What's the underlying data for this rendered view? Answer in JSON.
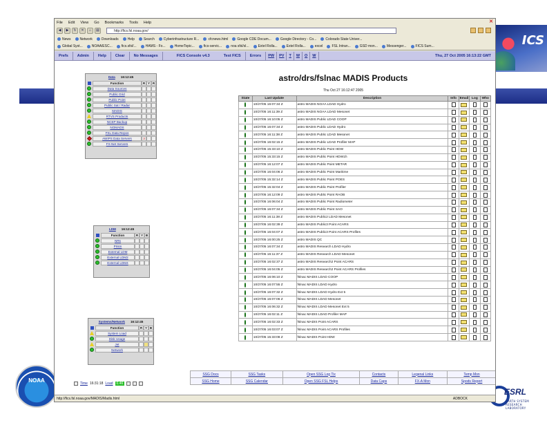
{
  "browser": {
    "menu": [
      "File",
      "Edit",
      "View",
      "Go",
      "Bookmarks",
      "Tools",
      "Help"
    ],
    "url": "http://fics.fsl.noaa.gov/",
    "bookmarks_row1": [
      "News",
      "Network",
      "Downloads",
      "Help",
      "Search",
      "Cyberinfrastructure R...",
      "cfcnews.html",
      "Google CDE Docum...",
      "Google Directory - Co...",
      "Colorado State Univer..."
    ],
    "bookmarks_row2": [
      "Global Syst...",
      "NOAA/ESC...",
      "fics.sfsl/...",
      "HAMS - Fo...",
      "HomeTopic...",
      "fics-servic...",
      "noa sfsl/sl...",
      "Extel Rolla...",
      "Extel Rolla...",
      "excel",
      "FSL Intran...",
      "GSD mon...",
      "Messenger...",
      "FICS Sum..."
    ],
    "status_url": "http://fics.fsl.noaa.gov/MADIS/Madis.html",
    "status_right": "ADBOCK"
  },
  "ssg_nav": {
    "tabs": [
      "Prefs",
      "Admin",
      "Help",
      "Clear",
      "No Messages"
    ],
    "title": "FICS Console v4.3",
    "tabs_right": [
      "Test FICS",
      "Errors"
    ],
    "letters": [
      "PW",
      "PV",
      "T",
      "W",
      "O",
      "W"
    ],
    "clock": "Thu, 27 Oct 2005 16:13:22 GMT"
  },
  "data_panel": {
    "header_link": "Data",
    "header_time": "16:12:45",
    "col_function": "Function",
    "col_r": "R",
    "col_y": "Y",
    "col_b": "R",
    "rows": [
      {
        "label": "Data Sources",
        "status": "green",
        "r": ""
      },
      {
        "label": "Public Grid",
        "status": "green",
        "r": ""
      },
      {
        "label": "Public Point",
        "status": "green",
        "r": ""
      },
      {
        "label": "Public Sat / Radar",
        "status": "green",
        "r": ""
      },
      {
        "label": "MADIS",
        "status": "green",
        "r": ""
      },
      {
        "label": "RTVS Products",
        "status": "yellow",
        "r": ""
      },
      {
        "label": "NCEP Backup",
        "status": "green",
        "r": ""
      },
      {
        "label": "NOMADS",
        "status": "green",
        "r": ""
      },
      {
        "label": "FSL Data Repos",
        "status": "green",
        "r": ""
      },
      {
        "label": "AWIPS Data Servers",
        "status": "red",
        "r": "3"
      },
      {
        "label": "FX-Net Servers",
        "status": "green",
        "r": ""
      }
    ]
  },
  "ldm_panel": {
    "header_link": "LDM",
    "header_time": "16:12:45",
    "col_function": "Function",
    "col_r": "R",
    "col_y": "Y",
    "col_b": "B",
    "rows": [
      {
        "label": "NRs",
        "status": "green"
      },
      {
        "label": "Prism",
        "status": "green"
      },
      {
        "label": "External LDM",
        "status": "green"
      },
      {
        "label": "External LDM2",
        "status": "green"
      },
      {
        "label": "External LDM4",
        "status": "green"
      }
    ]
  },
  "sys_panel": {
    "header_link": "Systems/Network",
    "header_time": "16:12:45",
    "col_function": "Function",
    "col_r": "R",
    "col_y": "Y",
    "col_b": "B",
    "rows": [
      {
        "label": "System Load",
        "status": "yellow",
        "y": ""
      },
      {
        "label": "Disk Usage",
        "status": "green",
        "y": ""
      },
      {
        "label": "Jet",
        "status": "yellow",
        "y": "fill"
      },
      {
        "label": "Network",
        "status": "green",
        "y": ""
      }
    ]
  },
  "time_bar": {
    "time_label": "Time",
    "time_value": "16:31:18",
    "load_label": "Load",
    "load_value": "0.46"
  },
  "products": {
    "title": "astro/drs/fslnac MADIS Products",
    "timestamp": "Thu Oct 27 16:12:47 2005",
    "columns": [
      "State",
      "Last Update",
      "Description",
      "Info",
      "Email",
      "Log",
      "Who"
    ],
    "rows": [
      {
        "time": "10/27/05 16:07:34 Z",
        "desc": "astro MADIS NOAA LDAD Hydro"
      },
      {
        "time": "10/27/05 16:11:39 Z",
        "desc": "astro MADIS NOAA LDAD Mesonet"
      },
      {
        "time": "10/27/05 16:10:05 Z",
        "desc": "astro MADIS Public LDAD COOP"
      },
      {
        "time": "10/27/05 16:07:34 Z",
        "desc": "astro MADIS Public LDAD Hydro"
      },
      {
        "time": "10/27/05 16:11:38 Z",
        "desc": "astro MADIS Public LDAD Mesonet"
      },
      {
        "time": "10/27/05 16:02:15 Z",
        "desc": "astro MADIS Public LDAD Profiler MAP"
      },
      {
        "time": "10/27/05 15:33:10 Z",
        "desc": "astro MADIS Public Point HDW"
      },
      {
        "time": "10/27/05 15:33:15 Z",
        "desc": "astro MADIS Public Point HDW1h"
      },
      {
        "time": "10/27/05 16:12:07 Z",
        "desc": "astro MADIS Public Point METAR"
      },
      {
        "time": "10/27/05 16:04:06 Z",
        "desc": "astro MADIS Public Point Maritime"
      },
      {
        "time": "10/27/05 15:32:14 Z",
        "desc": "astro MADIS Public Point POES"
      },
      {
        "time": "10/27/05 15:32:04 Z",
        "desc": "astro MADIS Public Point Profiler"
      },
      {
        "time": "10/27/05 16:12:09 Z",
        "desc": "astro MADIS Public Point RAOB"
      },
      {
        "time": "10/27/05 16:06:04 Z",
        "desc": "astro MADIS Public Point Radiometer"
      },
      {
        "time": "10/27/05 16:07:34 Z",
        "desc": "astro MADIS Public Point SAO"
      },
      {
        "time": "10/27/05 16:11:38 Z",
        "desc": "astro MADIS Public2 LDAD Mesonet"
      },
      {
        "time": "10/27/05 16:02:39 Z",
        "desc": "astro MADIS Public3 Point ACARS"
      },
      {
        "time": "10/27/05 16:04:07 Z",
        "desc": "astro MADIS Public3 Point ACARS Profiles"
      },
      {
        "time": "10/27/05 16:00:25 Z",
        "desc": "astro MADIS QC"
      },
      {
        "time": "10/27/05 16:07:34 Z",
        "desc": "astro MADIS Research LDAD Hydro"
      },
      {
        "time": "10/27/05 16:11:37 Z",
        "desc": "astro MADIS Research LDAD Mesonet"
      },
      {
        "time": "10/27/05 16:02:37 Z",
        "desc": "astro MADIS Research2 Point ACARS"
      },
      {
        "time": "10/27/05 16:04:05 Z",
        "desc": "astro MADIS Research2 Point ACARS Profiles"
      },
      {
        "time": "10/27/05 16:06:10 Z",
        "desc": "fslnac MADIS LDAD COOP"
      },
      {
        "time": "10/27/05 16:07:55 Z",
        "desc": "fslnac MADIS LDAD Hydro"
      },
      {
        "time": "10/27/05 16:07:32 Z",
        "desc": "fslnac MADIS LDAD Hydro Ext 5"
      },
      {
        "time": "10/27/05 16:07:06 Z",
        "desc": "fslnac MADIS LDAD Mesonet"
      },
      {
        "time": "10/27/05 16:06:32 Z",
        "desc": "fslnac MADIS LDAD Mesonet Ext 5"
      },
      {
        "time": "10/27/05 16:02:11 Z",
        "desc": "fslnac MADIS LDAD Profiler MAP"
      },
      {
        "time": "10/27/05 16:02:33 Z",
        "desc": "fslnac MADIS Point ACARS"
      },
      {
        "time": "10/27/05 16:03:07 Z",
        "desc": "fslnac MADIS Point ACARS Profiles"
      },
      {
        "time": "10/27/05 15:33:08 Z",
        "desc": "fslnac MADIS Point HDW"
      }
    ]
  },
  "bottom_links": [
    [
      "SSG Docs",
      "SSG Tasks",
      "Open SSG Log Tix",
      "Contacts",
      "Legenal Links",
      "Temp Mon"
    ],
    [
      "SSG Home",
      "SSG Calendar",
      "Open SSG FSL Helps",
      "Data Caps",
      "FX-A Mon",
      "Spods Report"
    ]
  ],
  "slide": {
    "left_logo_text": "NOAA",
    "right_logo_text": "ESRL",
    "right_logo_sub": "EARTH SYSTEM RESEARCH LABORATORY",
    "corner_text": "ICS"
  },
  "colors": {
    "green": "#2bbf2b",
    "yellow": "#e8d020",
    "red": "#d02020",
    "nav_blue": "#1a2a8a"
  }
}
